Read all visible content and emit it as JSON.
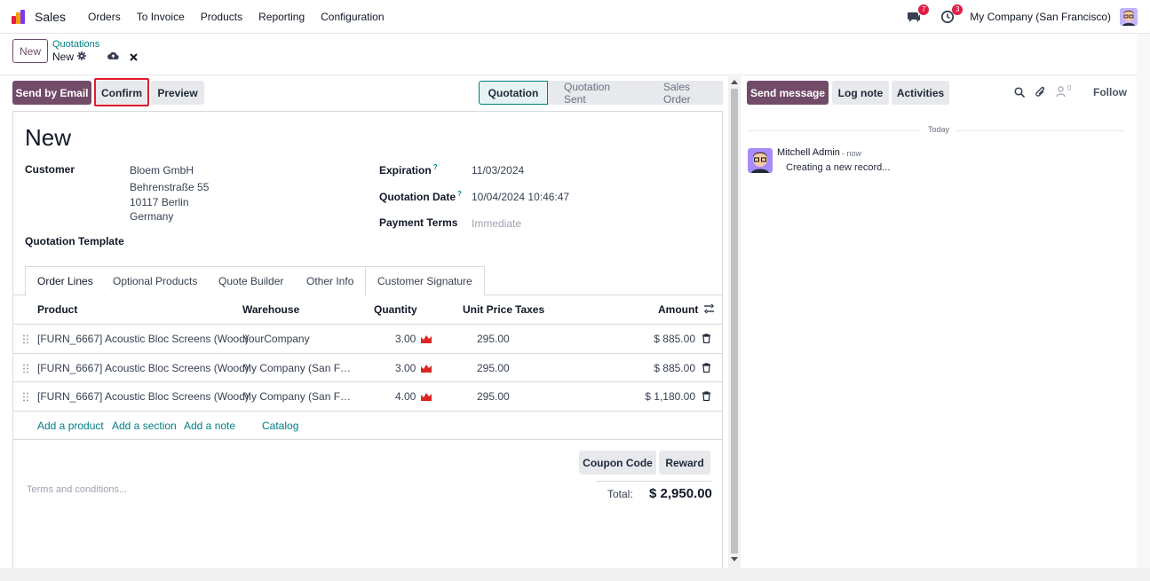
{
  "navbar": {
    "app_name": "Sales",
    "menu": [
      "Orders",
      "To Invoice",
      "Products",
      "Reporting",
      "Configuration"
    ],
    "messages_count": "7",
    "activities_count": "3",
    "company": "My Company (San Francisco)"
  },
  "control": {
    "new_label": "New",
    "breadcrumb_parent": "Quotations",
    "breadcrumb_current": "New"
  },
  "actions": {
    "send_email": "Send by Email",
    "confirm": "Confirm",
    "preview": "Preview"
  },
  "stages": [
    "Quotation",
    "Quotation Sent",
    "Sales Order"
  ],
  "form": {
    "title": "New",
    "customer_label": "Customer",
    "customer_name": "Bloem GmbH",
    "customer_street": "Behrenstraße 55",
    "customer_city": "10117 Berlin",
    "customer_country": "Germany",
    "template_label": "Quotation Template",
    "expiration_label": "Expiration",
    "expiration_value": "11/03/2024",
    "quotation_date_label": "Quotation Date",
    "quotation_date_value": "10/04/2024 10:46:47",
    "payment_terms_label": "Payment Terms",
    "payment_terms_value": "Immediate",
    "help_mark": "?"
  },
  "tabs": [
    "Order Lines",
    "Optional Products",
    "Quote Builder",
    "Other Info",
    "Customer Signature"
  ],
  "table": {
    "headers": {
      "product": "Product",
      "warehouse": "Warehouse",
      "quantity": "Quantity",
      "unit_price": "Unit Price",
      "taxes": "Taxes",
      "amount": "Amount"
    },
    "rows": [
      {
        "product": "[FURN_6667] Acoustic Bloc Screens (Wood)",
        "warehouse": "YourCompany",
        "quantity": "3.00",
        "unit_price": "295.00",
        "amount": "$ 885.00"
      },
      {
        "product": "[FURN_6667] Acoustic Bloc Screens (Wood)",
        "warehouse": "My Company (San F…",
        "quantity": "3.00",
        "unit_price": "295.00",
        "amount": "$ 885.00"
      },
      {
        "product": "[FURN_6667] Acoustic Bloc Screens (Wood)",
        "warehouse": "My Company (San F…",
        "quantity": "4.00",
        "unit_price": "295.00",
        "amount": "$ 1,180.00"
      }
    ],
    "add_product": "Add a product",
    "add_section": "Add a section",
    "add_note": "Add a note",
    "catalog": "Catalog"
  },
  "footer": {
    "coupon_code": "Coupon Code",
    "reward": "Reward",
    "terms_placeholder": "Terms and conditions...",
    "total_label": "Total:",
    "total_value": "$ 2,950.00"
  },
  "chatter": {
    "send_message": "Send message",
    "log_note": "Log note",
    "activities": "Activities",
    "followers_count": "0",
    "follow": "Follow",
    "date_separator": "Today",
    "message_author": "Mitchell Admin",
    "message_time": "- now",
    "message_body": "Creating a new record..."
  },
  "colors": {
    "primary": "#714b67",
    "accent": "#017e84",
    "highlight": "#e11d2a",
    "badge": "#e11d48"
  }
}
